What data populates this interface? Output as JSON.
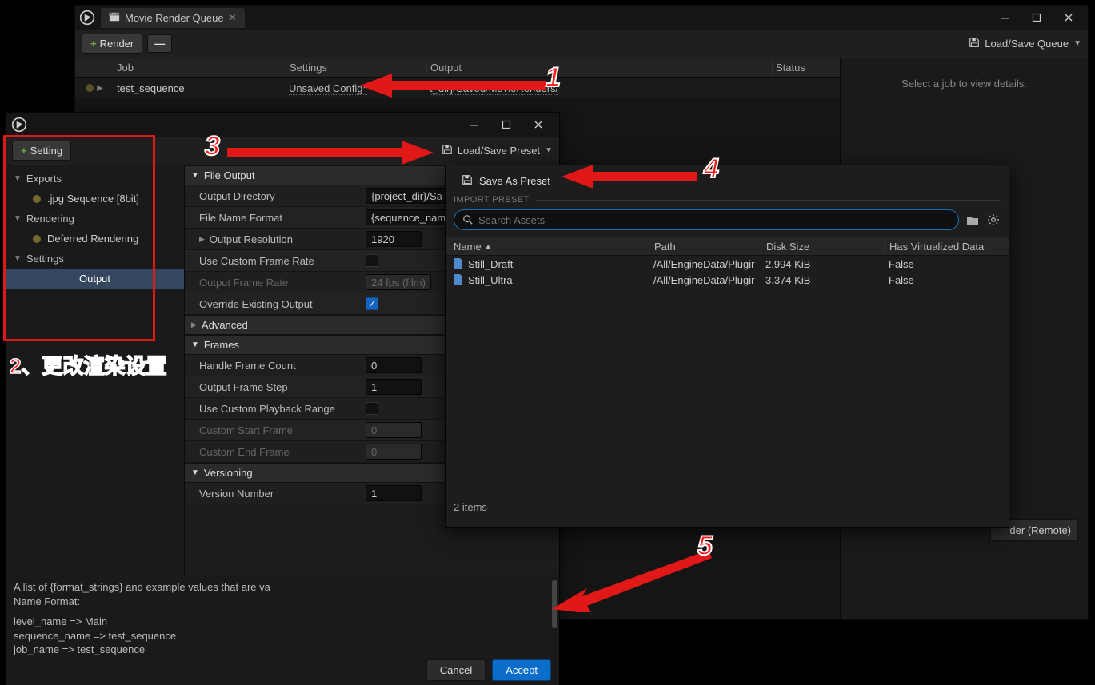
{
  "mrq": {
    "tab_title": "Movie Render Queue",
    "toolbar": {
      "render": "Render",
      "load_save_queue": "Load/Save Queue"
    },
    "columns": {
      "job": "Job",
      "settings": "Settings",
      "output": "Output",
      "status": "Status"
    },
    "row": {
      "job": "test_sequence",
      "settings": "Unsaved Config*",
      "output": "t_dir}/Saved/MovieRenders/"
    },
    "right_hint": "Select a job to view details.",
    "footer_remote": "der (Remote)"
  },
  "cfg": {
    "toolbar": {
      "setting": "Setting",
      "load_save_preset": "Load/Save Preset"
    },
    "sidebar": {
      "sections": {
        "exports": "Exports",
        "rendering": "Rendering",
        "settings": "Settings"
      },
      "items": {
        "jpg": ".jpg Sequence [8bit]",
        "deferred": "Deferred Rendering",
        "output": "Output"
      }
    },
    "sections": {
      "file_output": "File Output",
      "frames": "Frames",
      "versioning": "Versioning",
      "advanced": "Advanced"
    },
    "props": {
      "output_directory": {
        "label": "Output Directory",
        "value": "{project_dir}/Sa"
      },
      "file_name_format": {
        "label": "File Name Format",
        "value": "{sequence_nam"
      },
      "output_resolution": {
        "label": "Output Resolution",
        "value": "1920"
      },
      "use_custom_frame_rate": {
        "label": "Use Custom Frame Rate"
      },
      "output_frame_rate": {
        "label": "Output Frame Rate",
        "value": "24 fps (film)"
      },
      "override_existing": {
        "label": "Override Existing Output"
      },
      "handle_frame_count": {
        "label": "Handle Frame Count",
        "value": "0"
      },
      "output_frame_step": {
        "label": "Output Frame Step",
        "value": "1"
      },
      "use_custom_playback_range": {
        "label": "Use Custom Playback Range"
      },
      "custom_start_frame": {
        "label": "Custom Start Frame",
        "value": "0"
      },
      "custom_end_frame": {
        "label": "Custom End Frame",
        "value": "0"
      },
      "version_number": {
        "label": "Version Number",
        "value": "1"
      }
    },
    "info": {
      "line1": "A list of {format_strings} and example values that are va",
      "line2": "Name Format:",
      "line3": "level_name => Main",
      "line4": "sequence_name => test_sequence",
      "line5": "job_name => test_sequence"
    },
    "footer": {
      "accept": "Accept",
      "cancel": "Cancel"
    }
  },
  "preset": {
    "save_as": "Save As Preset",
    "import_label": "IMPORT PRESET",
    "search_placeholder": "Search Assets",
    "columns": {
      "name": "Name",
      "path": "Path",
      "size": "Disk Size",
      "virt": "Has Virtualized Data"
    },
    "rows": [
      {
        "name": "Still_Draft",
        "path": "/All/EngineData/Plugir",
        "size": "2.994 KiB",
        "virt": "False"
      },
      {
        "name": "Still_Ultra",
        "path": "/All/EngineData/Plugir",
        "size": "3.374 KiB",
        "virt": "False"
      }
    ],
    "footer": "2 items"
  },
  "annotations": {
    "n1": "1",
    "n2": "2、更改渲染设置",
    "n3": "3",
    "n4": "4",
    "n5": "5"
  }
}
